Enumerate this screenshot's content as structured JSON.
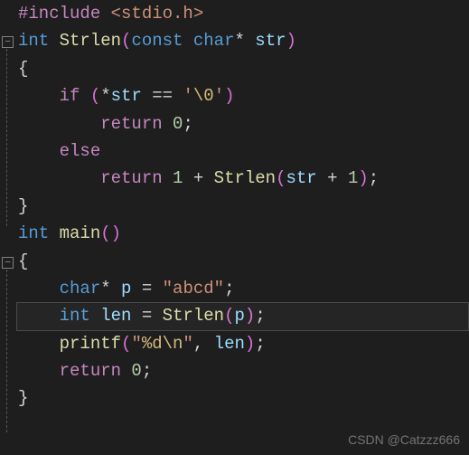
{
  "code": {
    "l1_include": "#include",
    "l1_header": " <stdio.h>",
    "l2_int": "int",
    "l2_fn": " Strlen",
    "l2_po": "(",
    "l2_const": "const",
    "l2_char": " char",
    "l2_star": "* ",
    "l2_param": "str",
    "l2_pc": ")",
    "l3_brace": "{",
    "l4_indent": "    ",
    "l4_if": "if ",
    "l4_po": "(",
    "l4_star": "*",
    "l4_var": "str",
    "l4_eq": " == ",
    "l4_qo": "'",
    "l4_esc": "\\0",
    "l4_qc": "'",
    "l4_pc": ")",
    "l5_indent": "        ",
    "l5_return": "return",
    "l5_val": " 0",
    "l5_semi": ";",
    "l6_indent": "    ",
    "l6_else": "else",
    "l7_indent": "        ",
    "l7_return": "return",
    "l7_one": " 1",
    "l7_plus": " + ",
    "l7_fn": "Strlen",
    "l7_po": "(",
    "l7_var": "str",
    "l7_plus2": " + ",
    "l7_one2": "1",
    "l7_pc": ")",
    "l7_semi": ";",
    "l8_brace": "}",
    "l9_int": "int",
    "l9_fn": " main",
    "l9_po": "(",
    "l9_pc": ")",
    "l10_brace": "{",
    "l11_indent": "    ",
    "l11_char": "char",
    "l11_star": "* ",
    "l11_var": "p",
    "l11_eq": " = ",
    "l11_str": "\"abcd\"",
    "l11_semi": ";",
    "l12_indent": "    ",
    "l12_int": "int",
    "l12_sp": " ",
    "l12_var": "len",
    "l12_eq": " = ",
    "l12_fn": "Strlen",
    "l12_po": "(",
    "l12_arg": "p",
    "l12_pc": ")",
    "l12_semi": ";",
    "l13_indent": "    ",
    "l13_fn": "printf",
    "l13_po": "(",
    "l13_qo": "\"",
    "l13_esc1": "%d",
    "l13_esc2": "\\n",
    "l13_qc": "\"",
    "l13_comma": ", ",
    "l13_var": "len",
    "l13_pc": ")",
    "l13_semi": ";",
    "l14_indent": "    ",
    "l14_return": "return",
    "l14_val": " 0",
    "l14_semi": ";",
    "l15_brace": "}"
  },
  "watermark": "CSDN @Catzzz666"
}
